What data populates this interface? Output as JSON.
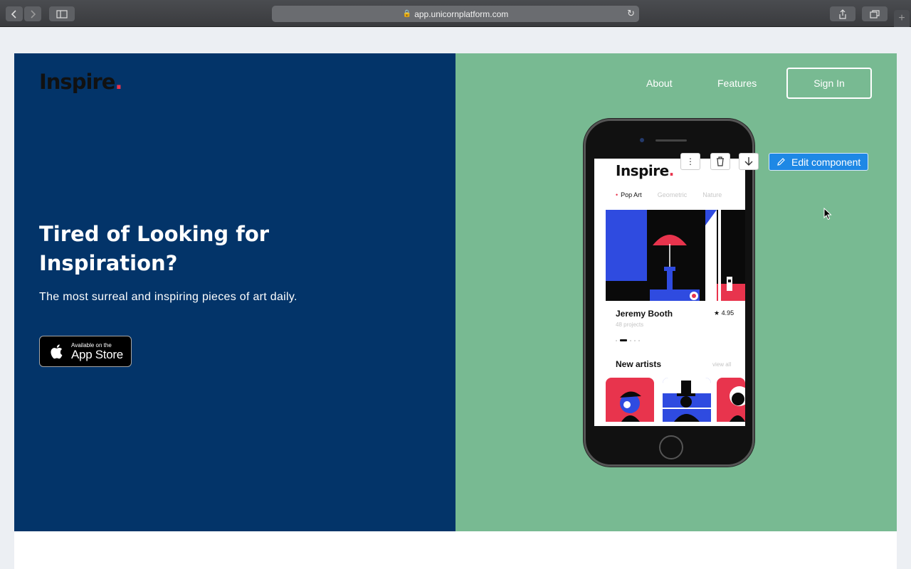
{
  "browser": {
    "url": "app.unicornplatform.com",
    "back_icon": "chevron-left-icon",
    "forward_icon": "chevron-right-icon",
    "sidebar_icon": "sidebar-icon",
    "reload_icon": "reload-icon",
    "share_icon": "share-icon",
    "tabs_icon": "tabs-icon",
    "newtab_icon": "plus-icon"
  },
  "page": {
    "logo": "Inspire",
    "logo_dot": ".",
    "nav": {
      "about": "About",
      "features": "Features",
      "sign_in": "Sign In"
    },
    "hero": {
      "title": "Tired of Looking for Inspiration?",
      "subtitle": "The most surreal and inspiring pieces of art daily."
    },
    "app_store": {
      "small": "Available on the",
      "big": "App Store"
    },
    "colors": {
      "left_bg": "#033469",
      "right_bg": "#78ba92",
      "accent": "#e8344d",
      "edit_button": "#1e88e5"
    }
  },
  "phone": {
    "logo": "Inspire",
    "logo_dot": ".",
    "tabs": [
      "Pop Art",
      "Geometric",
      "Nature"
    ],
    "artist_name": "Jeremy Booth",
    "rating": "4.95",
    "projects": "48 projects",
    "new_artists": "New artists",
    "view_all": "view all"
  },
  "editor": {
    "edit_label": "Edit component",
    "tools": [
      "more-icon",
      "trash-icon",
      "arrow-down-icon"
    ]
  }
}
